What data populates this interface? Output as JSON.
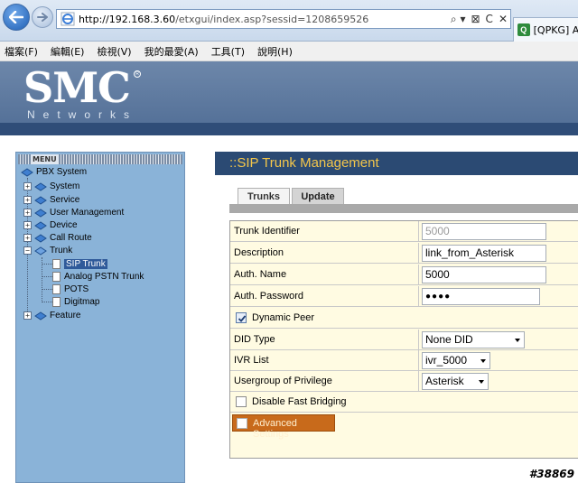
{
  "browser": {
    "url_host": "http://192.168.3.60",
    "url_path": "/etxgui/index.asp?sessid=1208659526",
    "tab_label": "[QPKG] As",
    "tab_icon_text": "Q",
    "addr_tools": [
      "⌕ ▾",
      "⊠",
      "C",
      "✕"
    ]
  },
  "menubar": {
    "items": [
      "檔案(F)",
      "編輯(E)",
      "檢視(V)",
      "我的最愛(A)",
      "工具(T)",
      "說明(H)"
    ]
  },
  "header": {
    "logo_main": "SMC",
    "logo_reg": "R",
    "logo_sub": "Networks"
  },
  "sidebar": {
    "menu_title": "MENU",
    "root": "PBX System",
    "items": [
      {
        "label": "System",
        "toggle": "+"
      },
      {
        "label": "Service",
        "toggle": "+"
      },
      {
        "label": "User Management",
        "toggle": "+"
      },
      {
        "label": "Device",
        "toggle": "+"
      },
      {
        "label": "Call Route",
        "toggle": "+"
      },
      {
        "label": "Trunk",
        "toggle": "−"
      }
    ],
    "trunk_children": [
      "SIP Trunk",
      "Analog PSTN Trunk",
      "POTS",
      "Digitmap"
    ],
    "last_item": {
      "label": "Feature",
      "toggle": "+"
    }
  },
  "main": {
    "title": "::SIP Trunk Management",
    "tabs": [
      "Trunks",
      "Update"
    ],
    "form": {
      "trunk_identifier": {
        "label": "Trunk Identifier",
        "value": "5000"
      },
      "description": {
        "label": "Description",
        "value": "link_from_Asterisk"
      },
      "auth_name": {
        "label": "Auth. Name",
        "value": "5000"
      },
      "auth_password": {
        "label": "Auth. Password",
        "value": "●●●●"
      },
      "dynamic_peer": {
        "label": "Dynamic Peer",
        "checked": true
      },
      "did_type": {
        "label": "DID Type",
        "value": "None DID"
      },
      "ivr_list": {
        "label": "IVR List",
        "value": "ivr_5000"
      },
      "usergroup": {
        "label": "Usergroup of Privilege",
        "value": "Asterisk"
      },
      "fast_bridging": {
        "label": "Disable Fast Bridging",
        "checked": false
      },
      "advanced": {
        "label": "Advanced Settings",
        "checked": false
      }
    }
  },
  "watermark": "#38869",
  "colors": {
    "title_text": "#f3c64b",
    "title_bar": "#2b4a73",
    "sidebar_bg": "#8ab3d8",
    "form_bg": "#fffbe2",
    "advanced_bg": "#c86a1b"
  }
}
